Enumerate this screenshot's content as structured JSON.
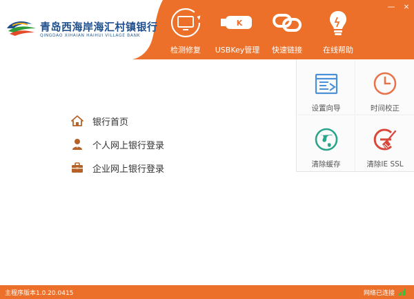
{
  "brand": {
    "name_cn": "青岛西海岸海汇村镇银行",
    "name_en": "QINGDAO XIHAIAN HAIHUI VILLAGE BANK",
    "primary_color": "#ec7029",
    "logo_blue": "#1e4f8c"
  },
  "window_controls": {
    "minimize": "—",
    "close": "×"
  },
  "nav": [
    {
      "label": "检测修复",
      "icon": "monitor-repair-icon"
    },
    {
      "label": "USBKey管理",
      "icon": "usbkey-icon",
      "key_letter": "K"
    },
    {
      "label": "快速链接",
      "icon": "chain-link-icon"
    },
    {
      "label": "在线帮助",
      "icon": "lightbulb-icon"
    }
  ],
  "links": [
    {
      "label": "银行首页",
      "icon": "home-icon"
    },
    {
      "label": "个人网上银行登录",
      "icon": "person-icon"
    },
    {
      "label": "企业网上银行登录",
      "icon": "briefcase-icon"
    }
  ],
  "tools": [
    {
      "label": "设置向导",
      "icon": "setup-wizard-icon"
    },
    {
      "label": "时间校正",
      "icon": "clock-icon"
    },
    {
      "label": "清除缓存",
      "icon": "globe-clean-icon"
    },
    {
      "label": "清除IE SSL",
      "icon": "broom-ie-icon"
    }
  ],
  "status": {
    "version": "主程序版本1.0.20.0415",
    "network": "网络已连接",
    "signal_color": "#3cbf3c"
  }
}
